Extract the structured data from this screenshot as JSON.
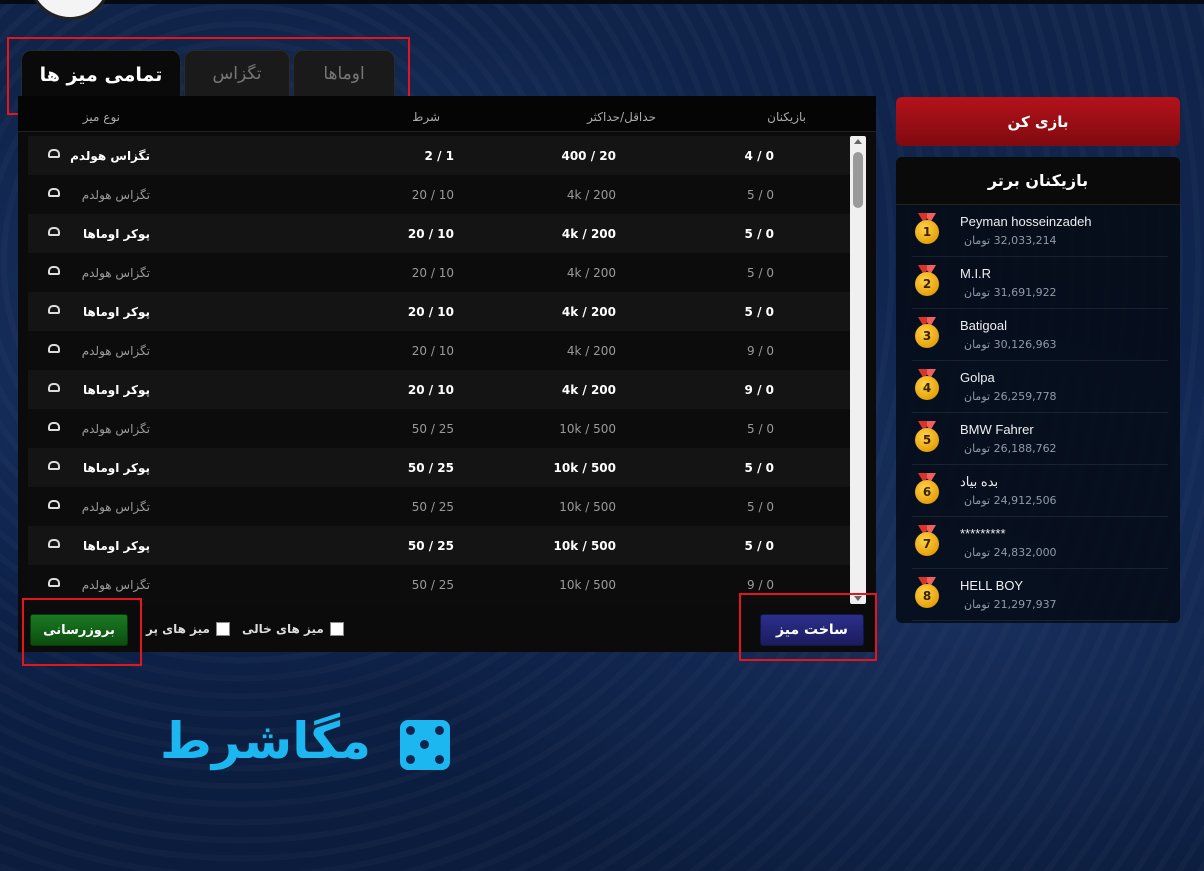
{
  "tabs": [
    {
      "label": "تمامی میز ها",
      "active": true
    },
    {
      "label": "تگزاس",
      "active": false
    },
    {
      "label": "اوماها",
      "active": false
    }
  ],
  "table": {
    "headers": {
      "players": "بازیکنان",
      "minmax": "حداقل/حداکثر",
      "bet": "شرط",
      "type": "نوع میز"
    },
    "rows": [
      {
        "type": "تگزاس هولدم",
        "bet": "1 / 2",
        "minmax": "20 / 400",
        "players": "0 / 4",
        "bold": true
      },
      {
        "type": "تگزاس هولدم",
        "bet": "10 / 20",
        "minmax": "200 / 4k",
        "players": "0 / 5",
        "bold": false
      },
      {
        "type": "پوکر اوماها",
        "bet": "10 / 20",
        "minmax": "200 / 4k",
        "players": "0 / 5",
        "bold": true
      },
      {
        "type": "تگزاس هولدم",
        "bet": "10 / 20",
        "minmax": "200 / 4k",
        "players": "0 / 5",
        "bold": false
      },
      {
        "type": "پوکر اوماها",
        "bet": "10 / 20",
        "minmax": "200 / 4k",
        "players": "0 / 5",
        "bold": true
      },
      {
        "type": "تگزاس هولدم",
        "bet": "10 / 20",
        "minmax": "200 / 4k",
        "players": "0 / 9",
        "bold": false
      },
      {
        "type": "پوکر اوماها",
        "bet": "10 / 20",
        "minmax": "200 / 4k",
        "players": "0 / 9",
        "bold": true
      },
      {
        "type": "تگزاس هولدم",
        "bet": "25 / 50",
        "minmax": "500 / 10k",
        "players": "0 / 5",
        "bold": false
      },
      {
        "type": "پوکر اوماها",
        "bet": "25 / 50",
        "minmax": "500 / 10k",
        "players": "0 / 5",
        "bold": true
      },
      {
        "type": "تگزاس هولدم",
        "bet": "25 / 50",
        "minmax": "500 / 10k",
        "players": "0 / 5",
        "bold": false
      },
      {
        "type": "پوکر اوماها",
        "bet": "25 / 50",
        "minmax": "500 / 10k",
        "players": "0 / 5",
        "bold": true
      },
      {
        "type": "تگزاس هولدم",
        "bet": "25 / 50",
        "minmax": "500 / 10k",
        "players": "0 / 9",
        "bold": false
      }
    ]
  },
  "footer": {
    "refresh_label": "بروزرسانی",
    "full_tables_label": "میز های پر",
    "empty_tables_label": "میز های خالی",
    "create_label": "ساخت میز"
  },
  "sidebar": {
    "play_label": "بازی کن",
    "top_title": "بازیکنان برتر",
    "currency": "تومان",
    "top_players": [
      {
        "rank": "1",
        "name": "Peyman hosseinzadeh",
        "score": "32,033,214"
      },
      {
        "rank": "2",
        "name": "M.I.R",
        "score": "31,691,922"
      },
      {
        "rank": "3",
        "name": "Batigoal",
        "score": "30,126,963"
      },
      {
        "rank": "4",
        "name": "Golpa",
        "score": "26,259,778"
      },
      {
        "rank": "5",
        "name": "BMW Fahrer",
        "score": "26,188,762"
      },
      {
        "rank": "6",
        "name": "بده بیاد",
        "score": "24,912,506"
      },
      {
        "rank": "7",
        "name": "*********",
        "score": "24,832,000"
      },
      {
        "rank": "8",
        "name": "HELL BOY",
        "score": "21,297,937"
      }
    ]
  },
  "logo": {
    "text": "مگاشرط"
  },
  "colors": {
    "play": "#b5121a",
    "refresh": "#1a7a22",
    "create": "#2c2f8a",
    "logo": "#1cb6f0",
    "highlight": "#e5161b"
  }
}
